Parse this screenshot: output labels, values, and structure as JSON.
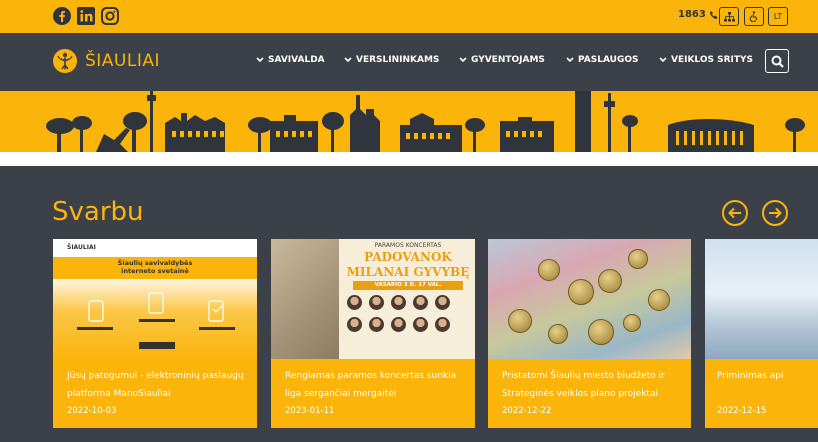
{
  "topbar": {
    "social": [
      {
        "name": "facebook"
      },
      {
        "name": "linkedin"
      },
      {
        "name": "instagram"
      }
    ],
    "phone": "1863",
    "language": "LT"
  },
  "header": {
    "logo_text": "ŠIAULIAI",
    "nav": [
      {
        "label": "SAVIVALDA"
      },
      {
        "label": "VERSLININKAMS"
      },
      {
        "label": "GYVENTOJAMS"
      },
      {
        "label": "PASLAUGOS"
      },
      {
        "label": "VEIKLOS SRITYS"
      }
    ]
  },
  "main": {
    "section_title": "Svarbu",
    "cards": [
      {
        "title": "Jūsų patogumui - elektroninių paslaugų platforma ManoSiauliai",
        "date": "2022-10-03"
      },
      {
        "title": "Rengiamas paramos koncertas sunkia liga sergančiai mergaitei",
        "date": "2023-01-11"
      },
      {
        "title": "Pristatomi Šiaulių miesto biudžeto ir Strateginės veiklos plano projektai",
        "date": "2022-12-22"
      },
      {
        "title": "Priminimas api",
        "date": "2022-12-15"
      }
    ],
    "card1_mock": {
      "logo": "ŠIAULIAI",
      "title_line1": "Šiaulių savivaldybės",
      "title_line2": "interneto svetainė"
    },
    "card2_poster": {
      "header": "PARAMOS KONCERTAS",
      "title_line1": "PADOVANOK",
      "title_line2": "MILANAI GYVYBĘ",
      "date": "VASARIO 3 D. 17 VAL."
    }
  },
  "colors": {
    "accent": "#fbb40a",
    "dark": "#3c4049"
  }
}
